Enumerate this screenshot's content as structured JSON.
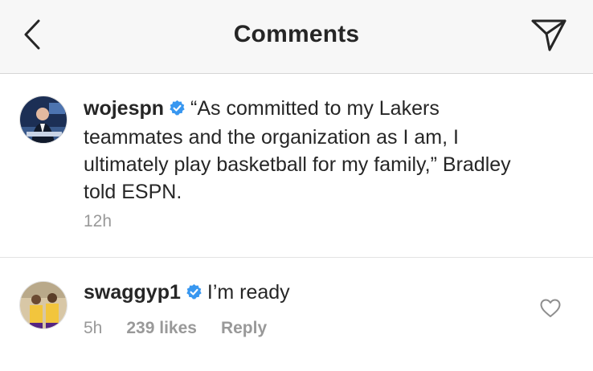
{
  "header": {
    "title": "Comments",
    "back_icon": "chevron-left-icon",
    "send_icon": "paper-plane-icon"
  },
  "comments": [
    {
      "username": "wojespn",
      "verified": true,
      "text": "“As committed to my Lakers teammates and the organization as I am, I ultimately play basketball for my family,” Bradley told ESPN.",
      "time": "12h"
    },
    {
      "username": "swaggyp1",
      "verified": true,
      "text": "I’m ready",
      "time": "5h",
      "likes": "239 likes",
      "reply_label": "Reply",
      "like_icon": "heart-outline-icon"
    }
  ],
  "colors": {
    "text": "#262626",
    "muted": "#999999",
    "verified": "#3897f0",
    "header_bg": "#f7f7f7"
  }
}
